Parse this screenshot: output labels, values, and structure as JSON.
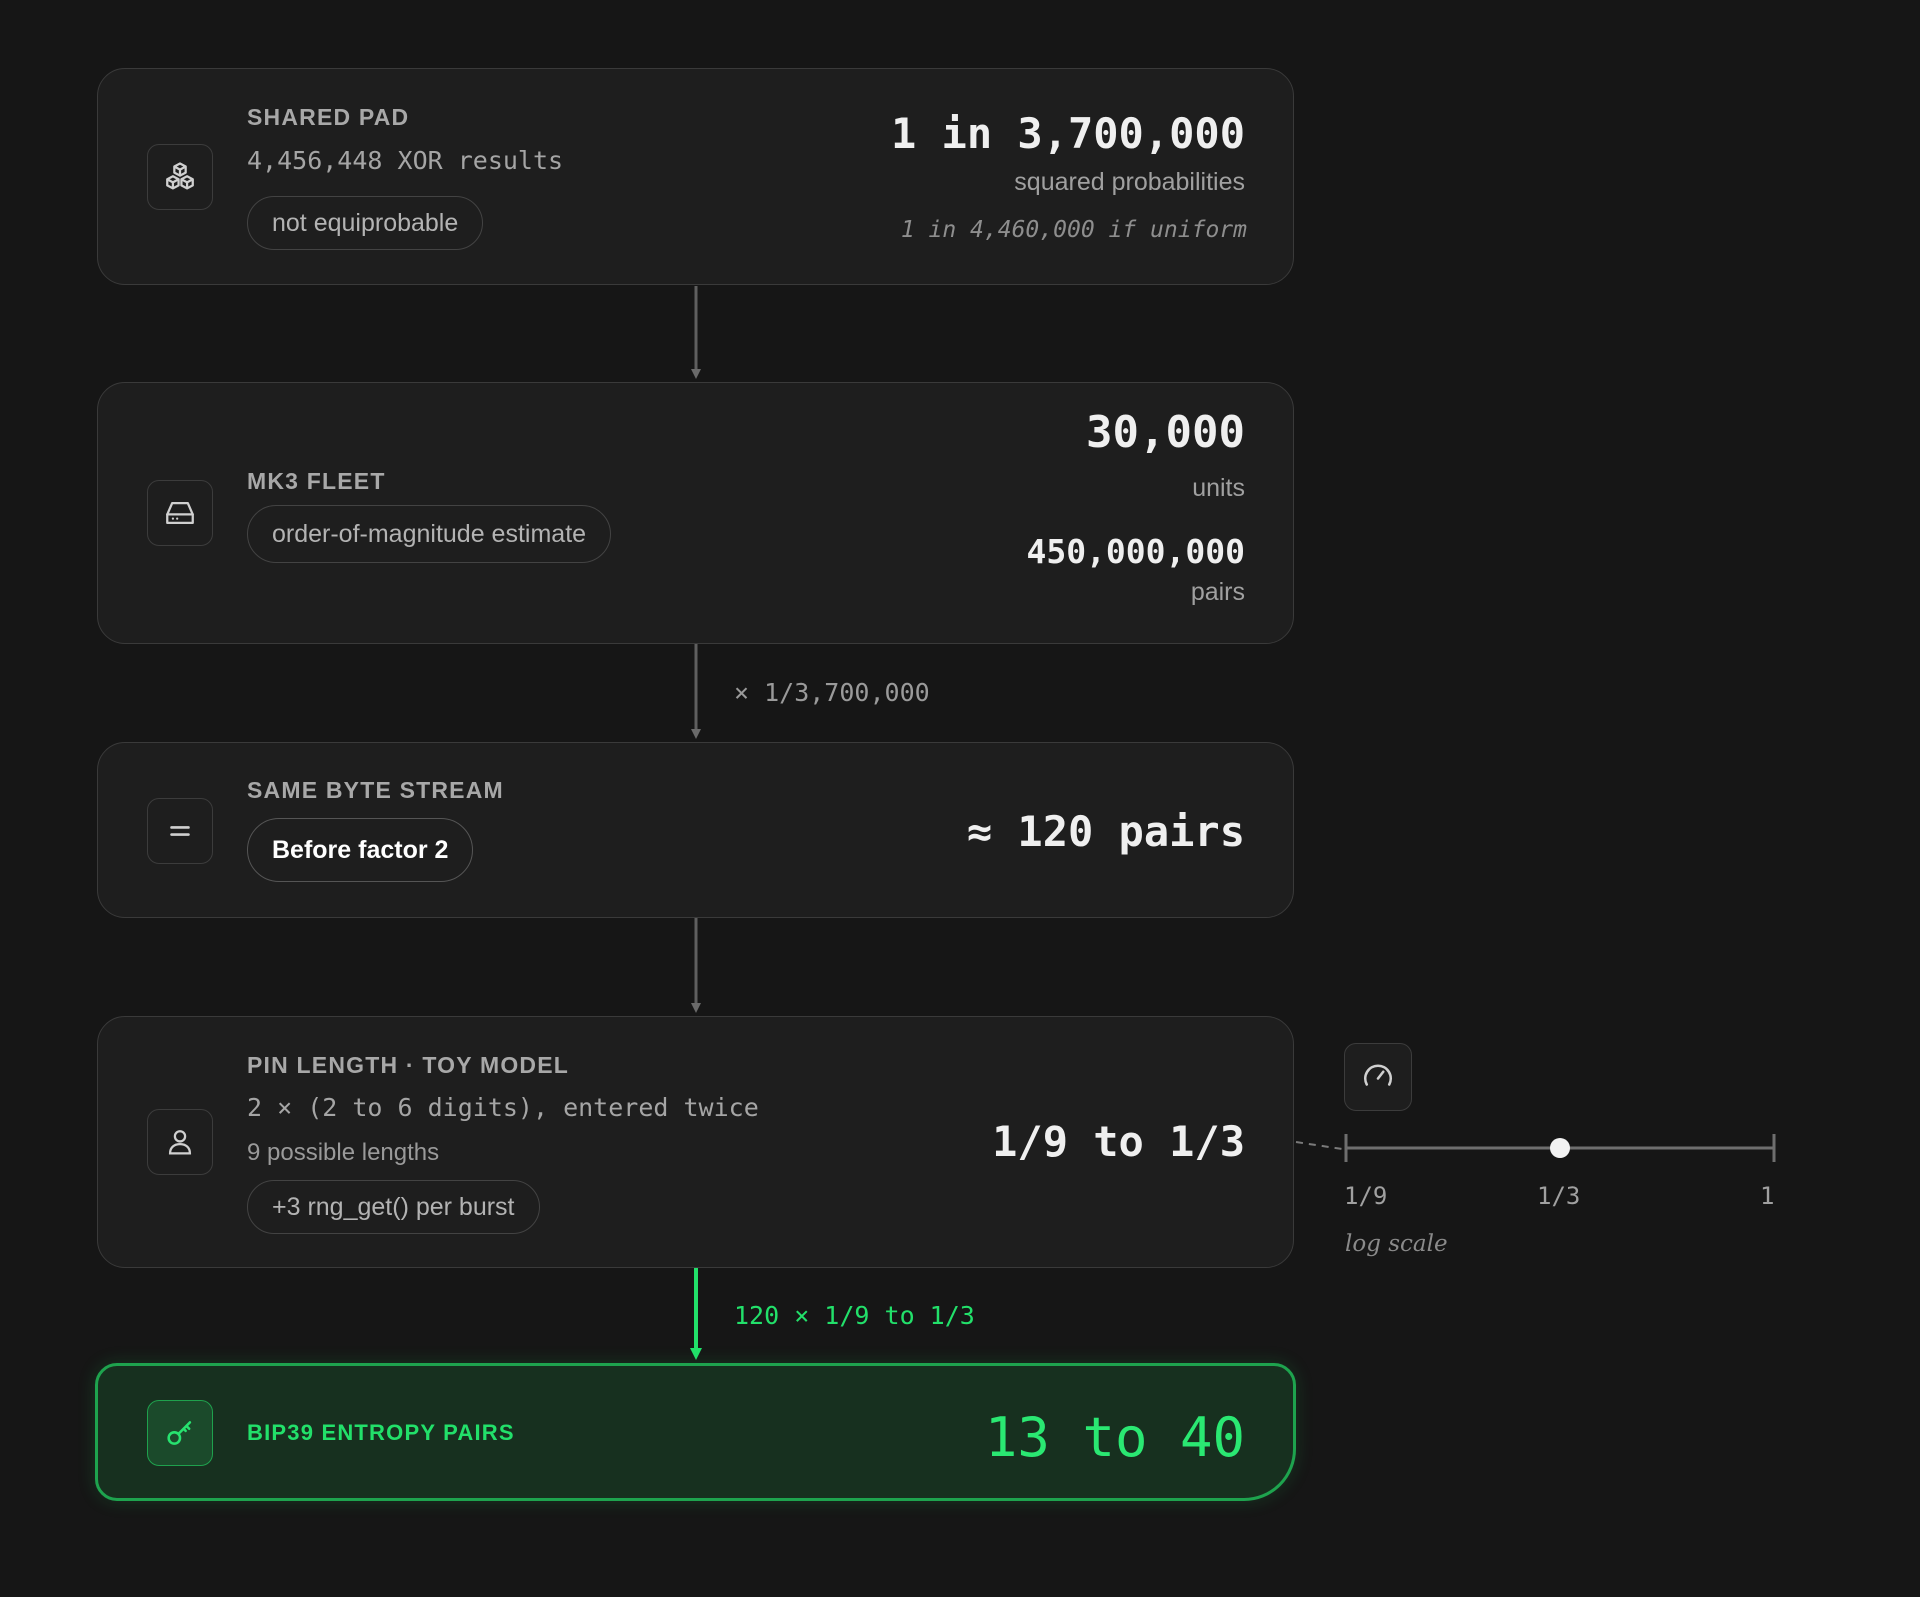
{
  "nodes": {
    "shared_pad": {
      "icon": "blocks-icon",
      "label": "SHARED PAD",
      "detail": "4,456,448 XOR results",
      "pill": "not equiprobable",
      "value": "1 in 3,700,000",
      "value_caption": "squared probabilities",
      "alt_caption": "1 in 4,460,000 if uniform"
    },
    "mk3_fleet": {
      "icon": "hard-drive-icon",
      "label": "MK3 FLEET",
      "pill": "order-of-magnitude estimate",
      "value": "30,000",
      "value_caption": "units",
      "value2": "450,000,000",
      "value2_caption": "pairs"
    },
    "same_byte_stream": {
      "icon": "equals-icon",
      "label": "SAME BYTE STREAM",
      "pill": "Before factor 2",
      "value": "≈ 120 pairs"
    },
    "pin_length": {
      "icon": "user-icon",
      "label": "PIN LENGTH · TOY MODEL",
      "detail": "2 × (2 to 6 digits), entered twice",
      "detail2": "9 possible lengths",
      "pill": "+3 rng_get() per burst",
      "value": "1/9 to 1/3"
    },
    "bip39": {
      "icon": "key-icon",
      "label": "BIP39 ENTROPY PAIRS",
      "value": "13 to 40"
    }
  },
  "connectors": {
    "fleet_to_stream": "× 1/3,700,000",
    "pin_to_bip39": "120 × 1/9 to 1/3"
  },
  "pin_scale": {
    "icon": "gauge-icon",
    "ticks": [
      "1/9",
      "1/3",
      "1"
    ],
    "marker_value": "1/3",
    "marker_fraction": 0.5,
    "note": "log scale"
  },
  "colors": {
    "background": "#161616",
    "card": "#1e1e1e",
    "accent_green": "#22e06a",
    "final_fill": "#17301f"
  }
}
